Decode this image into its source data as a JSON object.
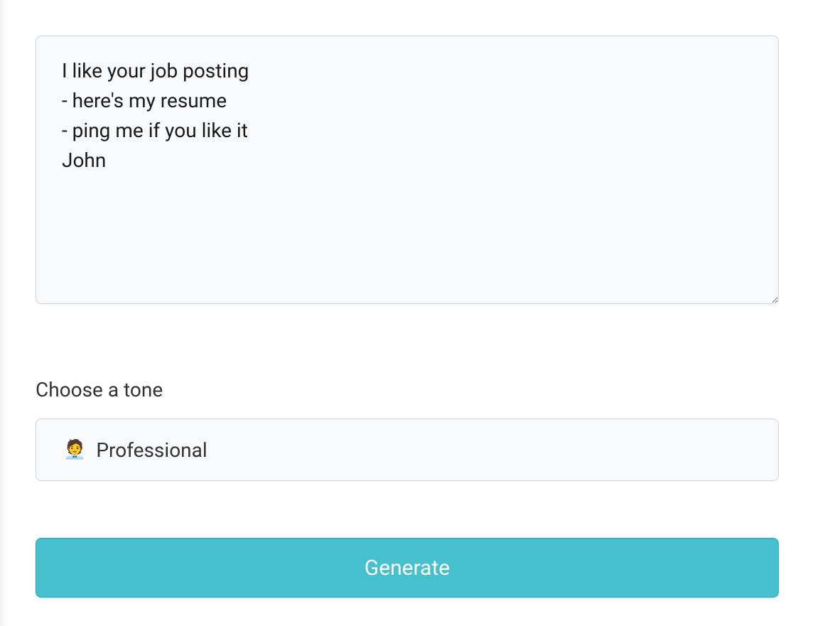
{
  "input": {
    "value": "I like your job posting\n- here's my resume\n- ping me if you like it\nJohn"
  },
  "tone": {
    "label": "Choose a tone",
    "selected_icon": "🧑‍💼",
    "selected_text": "Professional"
  },
  "generate": {
    "label": "Generate"
  }
}
